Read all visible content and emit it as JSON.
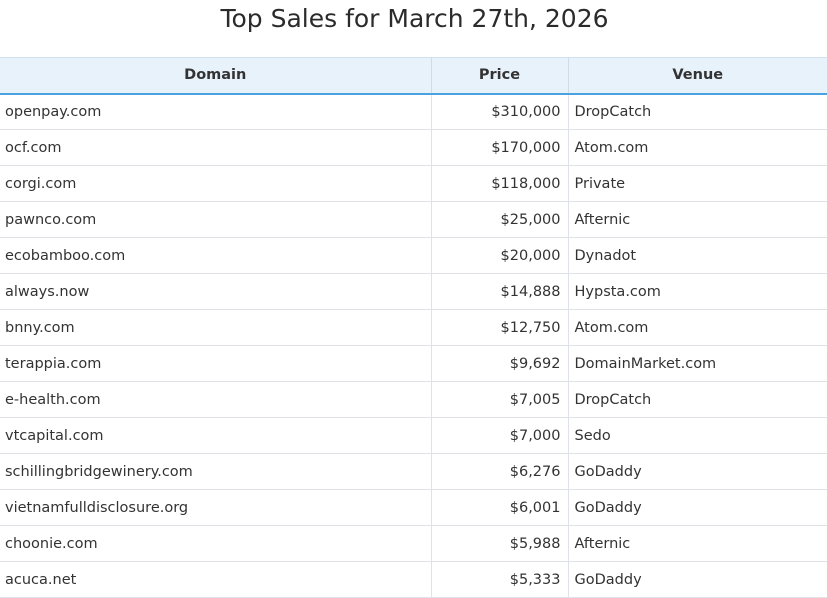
{
  "page": {
    "title": "Top Sales for March 27th, 2026"
  },
  "table": {
    "headers": [
      "Domain",
      "Price",
      "Venue"
    ],
    "rows": [
      {
        "domain": "openpay.com",
        "price": "$310,000",
        "venue": "DropCatch"
      },
      {
        "domain": "ocf.com",
        "price": "$170,000",
        "venue": "Atom.com"
      },
      {
        "domain": "corgi.com",
        "price": "$118,000",
        "venue": "Private"
      },
      {
        "domain": "pawnco.com",
        "price": "$25,000",
        "venue": "Afternic"
      },
      {
        "domain": "ecobamboo.com",
        "price": "$20,000",
        "venue": "Dynadot"
      },
      {
        "domain": "always.now",
        "price": "$14,888",
        "venue": "Hypsta.com"
      },
      {
        "domain": "bnny.com",
        "price": "$12,750",
        "venue": "Atom.com"
      },
      {
        "domain": "terappia.com",
        "price": "$9,692",
        "venue": "DomainMarket.com"
      },
      {
        "domain": "e-health.com",
        "price": "$7,005",
        "venue": "DropCatch"
      },
      {
        "domain": "vtcapital.com",
        "price": "$7,000",
        "venue": "Sedo"
      },
      {
        "domain": "schillingbridgewinery.com",
        "price": "$6,276",
        "venue": "GoDaddy"
      },
      {
        "domain": "vietnamfulldisclosure.org",
        "price": "$6,001",
        "venue": "GoDaddy"
      },
      {
        "domain": "choonie.com",
        "price": "$5,988",
        "venue": "Afternic"
      },
      {
        "domain": "acuca.net",
        "price": "$5,333",
        "venue": "GoDaddy"
      }
    ]
  },
  "colors": {
    "header_background": "#e8f2fb",
    "header_accent": "#4aa3df",
    "text": "#333333"
  }
}
